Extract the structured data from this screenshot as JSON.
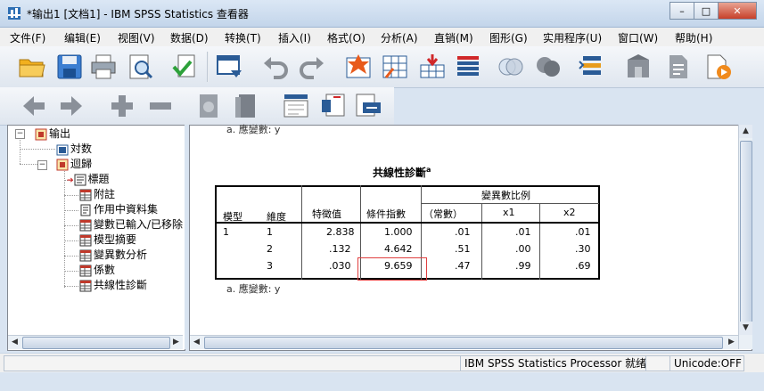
{
  "window": {
    "title": "*输出1 [文档1] - IBM SPSS Statistics 查看器",
    "minimize_label": "–",
    "maximize_label": "□",
    "close_label": "✕"
  },
  "menu": [
    {
      "label": "文件(F)"
    },
    {
      "label": "编辑(E)"
    },
    {
      "label": "视图(V)"
    },
    {
      "label": "数据(D)"
    },
    {
      "label": "转换(T)"
    },
    {
      "label": "插入(I)"
    },
    {
      "label": "格式(O)"
    },
    {
      "label": "分析(A)"
    },
    {
      "label": "直销(M)"
    },
    {
      "label": "图形(G)"
    },
    {
      "label": "实用程序(U)"
    },
    {
      "label": "窗口(W)"
    },
    {
      "label": "帮助(H)"
    }
  ],
  "toolbar1": [
    {
      "icon": "open-folder-icon"
    },
    {
      "icon": "save-icon"
    },
    {
      "icon": "print-icon"
    },
    {
      "icon": "print-preview-icon"
    },
    {
      "icon": "export-icon"
    },
    {
      "icon": "recall-dialog-icon"
    },
    {
      "icon": "undo-icon"
    },
    {
      "icon": "redo-icon"
    },
    {
      "icon": "goto-data-icon"
    },
    {
      "icon": "goto-case-icon"
    },
    {
      "icon": "goto-variable-icon"
    },
    {
      "icon": "variables-icon"
    },
    {
      "icon": "use-sets-icon"
    },
    {
      "icon": "show-all-icon"
    },
    {
      "icon": "spell-check-icon"
    },
    {
      "icon": "designate-window-icon"
    },
    {
      "icon": "script-icon"
    },
    {
      "icon": "text-output-icon"
    },
    {
      "icon": "run-icon"
    }
  ],
  "toolbar2": [
    {
      "icon": "promote-arrow-icon"
    },
    {
      "icon": "demote-arrow-icon"
    },
    {
      "icon": "expand-plus-icon"
    },
    {
      "icon": "collapse-minus-icon"
    },
    {
      "icon": "show-icon"
    },
    {
      "icon": "hide-icon"
    },
    {
      "icon": "insert-heading-icon"
    },
    {
      "icon": "insert-title-icon"
    },
    {
      "icon": "insert-text-icon"
    }
  ],
  "tree": {
    "root": "输出",
    "log": "対数",
    "regression": "迴歸",
    "items": [
      "標題",
      "附註",
      "作用中資料集",
      "變數已輸入/已移除",
      "模型摘要",
      "變異數分析",
      "係數",
      "共線性診斷"
    ]
  },
  "output": {
    "top_note": "a. 應變數: y",
    "table_title": "共線性診斷",
    "title_sup": "a",
    "bottom_note": "a. 應變數: y",
    "headers": {
      "model": "模型",
      "dimension": "維度",
      "eigenvalue": "特徵值",
      "condition_index": "條件指數",
      "variance_proportions": "變異數比例",
      "const": "（常數）",
      "x1": "x1",
      "x2": "x2"
    },
    "model_number": "1",
    "rows": [
      {
        "dim": "1",
        "eigen": "2.838",
        "cond": "1.000",
        "const": ".01",
        "x1": ".01",
        "x2": ".01"
      },
      {
        "dim": "2",
        "eigen": ".132",
        "cond": "4.642",
        "const": ".51",
        "x1": ".00",
        "x2": ".30"
      },
      {
        "dim": "3",
        "eigen": ".030",
        "cond": "9.659",
        "const": ".47",
        "x1": ".99",
        "x2": ".69"
      }
    ]
  },
  "status": {
    "processor": "IBM SPSS Statistics Processor 就绪",
    "unicode": "Unicode:OFF"
  },
  "colors": {
    "accent_red": "#e04040",
    "window_bg": "#d9e4f1"
  }
}
